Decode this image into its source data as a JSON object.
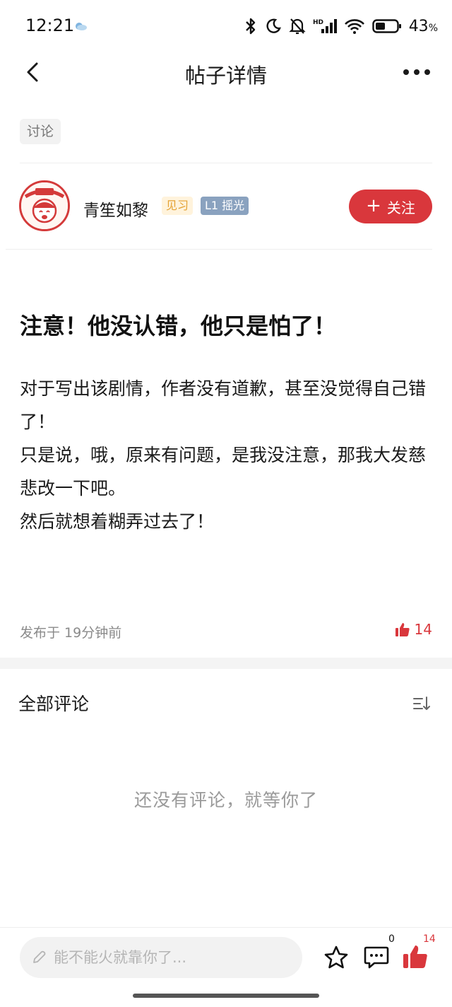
{
  "status_bar": {
    "time": "12:21",
    "battery_percent": "43",
    "battery_unit": "%",
    "icons": [
      "weather-icon",
      "bluetooth-icon",
      "moon-icon",
      "bell-off-icon",
      "hd-signal-icon",
      "wifi-icon",
      "battery-icon"
    ]
  },
  "nav": {
    "title": "帖子详情",
    "back_icon": "chevron-left-icon",
    "more_icon": "more-dots-icon"
  },
  "post": {
    "tag": "讨论",
    "author": {
      "name": "青笙如黎",
      "badge_apprentice": "见习",
      "badge_level": "L1 摇光"
    },
    "follow_label": "关注",
    "title": "注意！他没认错，他只是怕了！",
    "body_lines": [
      "对于写出该剧情，作者没有道歉，甚至没觉得自己错了！",
      "只是说，哦，原来有问题，是我没注意，那我大发慈悲改一下吧。",
      "然后就想着糊弄过去了！"
    ],
    "published": "发布于 19分钟前",
    "likes": "14"
  },
  "comments": {
    "title": "全部评论",
    "empty_text": "还没有评论，就等你了"
  },
  "bottom_bar": {
    "input_placeholder": "能不能火就靠你了...",
    "comment_count": "0",
    "like_count": "14"
  },
  "colors": {
    "accent": "#d9373c",
    "badge_apprentice_bg": "#fff3dc",
    "badge_apprentice_fg": "#e4a234",
    "badge_level_bg": "#8aa2bf"
  }
}
